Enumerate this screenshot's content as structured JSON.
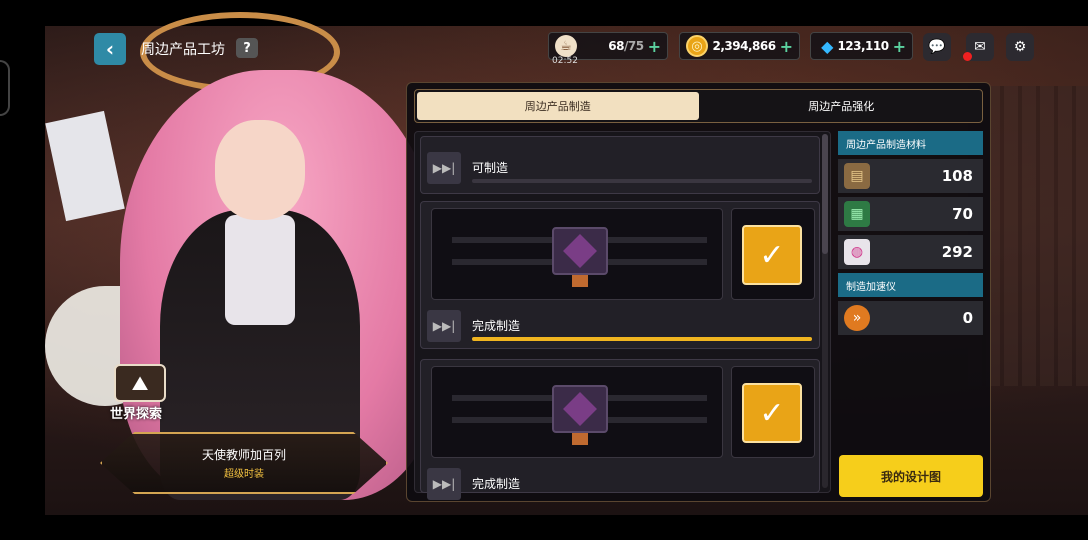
{
  "header": {
    "title": "周边产品工坊",
    "help_label": "?",
    "back_icon": "chevron-left-icon"
  },
  "resources": {
    "stamina": {
      "icon": "coffee-icon",
      "value": "68",
      "max": "/75",
      "timer": "02:52"
    },
    "gold": {
      "icon": "coin-icon",
      "value": "2,394,866"
    },
    "gems": {
      "icon": "diamond-icon",
      "value": "123,110"
    },
    "plus": "+"
  },
  "tabs": [
    {
      "label": "周边产品制造",
      "active": true
    },
    {
      "label": "周边产品强化",
      "active": false
    }
  ],
  "slots": [
    {
      "status": "可制造",
      "progress": 0
    },
    {
      "status": "完成制造",
      "progress": 1.0
    },
    {
      "status": "完成制造",
      "progress": 1.0
    }
  ],
  "skip_label": "▶▶|",
  "check_label": "✓",
  "materials": {
    "header": "周边产品制造材料",
    "items": [
      {
        "icon": "wood-plank-icon",
        "value": "108"
      },
      {
        "icon": "circuit-board-icon",
        "value": "70"
      },
      {
        "icon": "paint-bucket-icon",
        "value": "292"
      }
    ]
  },
  "accelerator": {
    "header": "制造加速仪",
    "items": [
      {
        "icon": "fast-forward-icon",
        "value": "0"
      }
    ]
  },
  "design_button": "我的设计图",
  "explore": {
    "label": "世界探索",
    "icon": "mountain-icon"
  },
  "character": {
    "name": "天使教师加百列",
    "tag": "超级时装"
  },
  "colors": {
    "accent": "#f6ce1b",
    "teal": "#1b6b86",
    "progress": "#f1b520"
  }
}
